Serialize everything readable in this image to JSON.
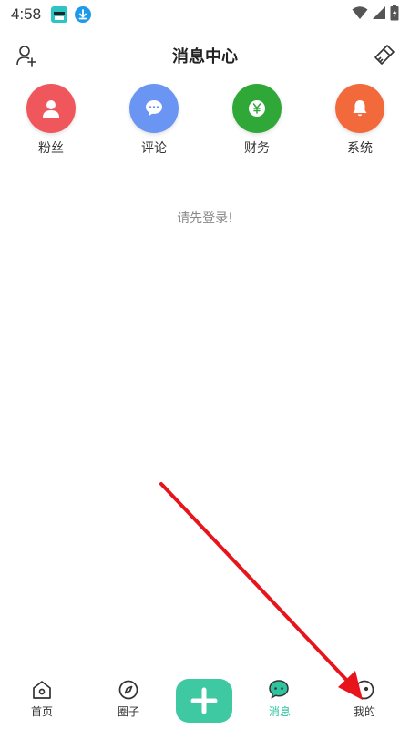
{
  "status_bar": {
    "time": "4:58"
  },
  "header": {
    "title": "消息中心",
    "left_icon": "add-friend-icon",
    "right_icon": "clear-brush-icon"
  },
  "categories": [
    {
      "label": "粉丝",
      "icon": "user-icon",
      "color": "#f0575c"
    },
    {
      "label": "评论",
      "icon": "chat-bubble-icon",
      "color": "#6b95f3"
    },
    {
      "label": "财务",
      "icon": "yen-coin-icon",
      "color": "#2fa838"
    },
    {
      "label": "系统",
      "icon": "bell-icon",
      "color": "#f26a3c"
    }
  ],
  "empty_message": "请先登录!",
  "bottom_nav": {
    "items": [
      {
        "label": "首页",
        "icon": "home-icon"
      },
      {
        "label": "圈子",
        "icon": "compass-icon"
      },
      {
        "label": "消息",
        "icon": "message-icon",
        "active": true
      },
      {
        "label": "我的",
        "icon": "profile-icon"
      }
    ],
    "plus_icon": "plus-icon",
    "active_color": "#2ec4a0",
    "plus_color": "#3ec9a3"
  },
  "annotation": {
    "arrow_color": "#e8141b"
  }
}
